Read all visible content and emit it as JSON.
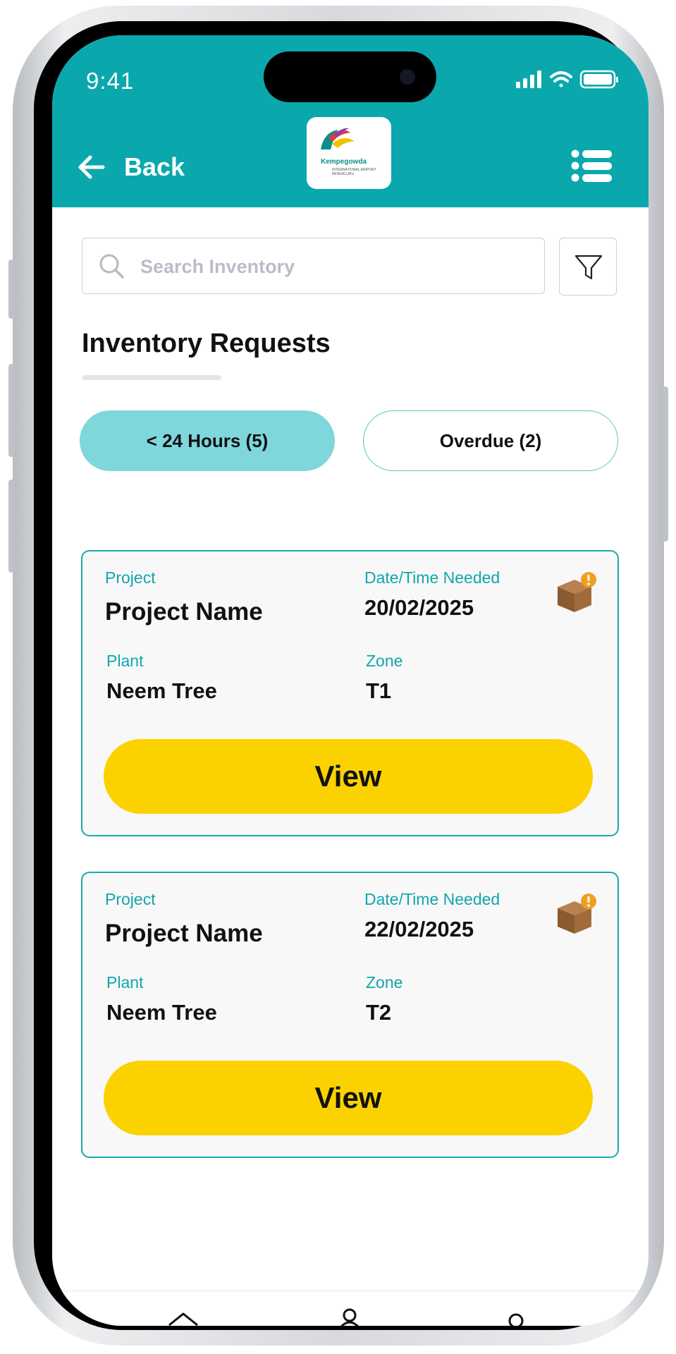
{
  "status_bar": {
    "time": "9:41"
  },
  "header": {
    "back_label": "Back",
    "logo": {
      "name": "Kempegowda",
      "subtitle": "INTERNATIONAL AIRPORT BENGALURU"
    },
    "icons": [
      "arrow-left-icon",
      "menu-list-icon"
    ],
    "background_color": "#0aa8ad"
  },
  "search": {
    "placeholder": "Search Inventory",
    "value": ""
  },
  "page_title": "Inventory Requests",
  "tabs": [
    {
      "label": "< 24 Hours (5)",
      "active": true
    },
    {
      "label": "Overdue (2)",
      "active": false
    }
  ],
  "cards": [
    {
      "project_label": "Project",
      "project": "Project Name",
      "date_label": "Date/Time Needed",
      "date": "20/02/2025",
      "plant_label": "Plant",
      "plant": "Neem Tree",
      "zone_label": "Zone",
      "zone": "T1",
      "button": "View"
    },
    {
      "project_label": "Project",
      "project": "Project Name",
      "date_label": "Date/Time Needed",
      "date": "22/02/2025",
      "plant_label": "Plant",
      "plant": "Neem Tree",
      "zone_label": "Zone",
      "zone": "T2",
      "button": "View"
    }
  ],
  "colors": {
    "accent": "#0aa8ad",
    "tab_active": "#7fd7dc",
    "button": "#fbd200",
    "label": "#12a6ab"
  }
}
